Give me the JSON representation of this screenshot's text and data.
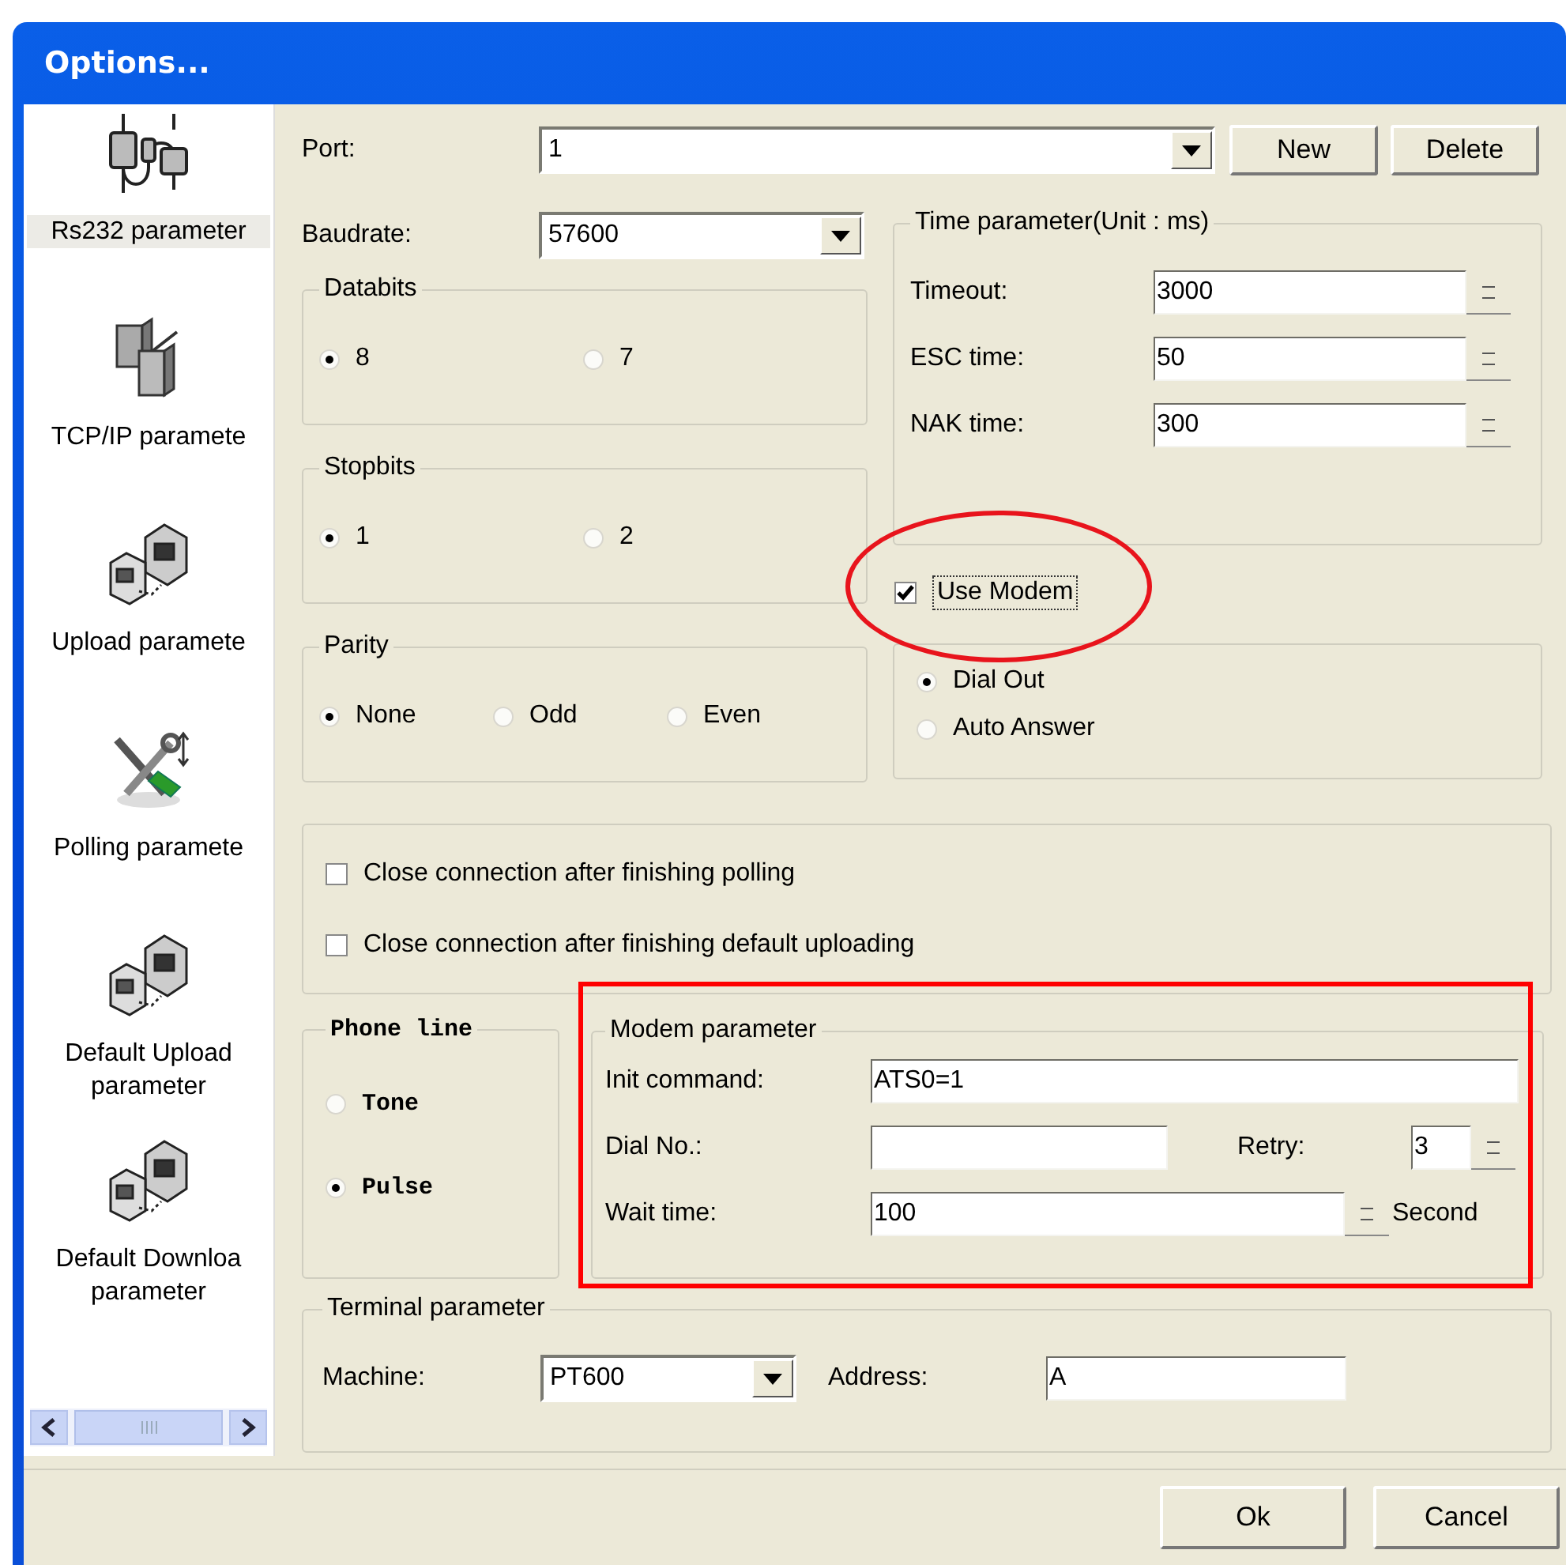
{
  "window": {
    "title": "Options..."
  },
  "sidebar": {
    "items": [
      {
        "label": "Rs232 parameter",
        "kind": "cable",
        "selected": true
      },
      {
        "label": "TCP/IP paramete",
        "kind": "servers",
        "selected": false
      },
      {
        "label": "Upload paramete",
        "kind": "computers",
        "selected": false
      },
      {
        "label": "Polling paramete",
        "kind": "tools",
        "selected": false
      },
      {
        "label": "Default Upload parameter",
        "kind": "computers",
        "selected": false
      },
      {
        "label": "Default Downloa parameter",
        "kind": "computers",
        "selected": false
      }
    ]
  },
  "port": {
    "label": "Port:",
    "value": "1"
  },
  "port_buttons": [
    "New",
    "Delete"
  ],
  "baudrate": {
    "label": "Baudrate:",
    "value": "57600"
  },
  "databits": {
    "legend": "Databits",
    "options": [
      {
        "label": "8",
        "selected": true
      },
      {
        "label": "7",
        "selected": false
      }
    ]
  },
  "stopbits": {
    "legend": "Stopbits",
    "options": [
      {
        "label": "1",
        "selected": true
      },
      {
        "label": "2",
        "selected": false
      }
    ]
  },
  "parity": {
    "legend": "Parity",
    "options": [
      {
        "label": "None",
        "selected": true
      },
      {
        "label": "Odd",
        "selected": false
      },
      {
        "label": "Even",
        "selected": false
      }
    ]
  },
  "time_parameter": {
    "legend": "Time parameter(Unit : ms)",
    "fields": [
      {
        "label": "Timeout:",
        "value": "3000"
      },
      {
        "label": "ESC time:",
        "value": "50"
      },
      {
        "label": "NAK time:",
        "value": "300"
      }
    ]
  },
  "use_modem": {
    "label": "Use Modem",
    "checked": true,
    "focused": true,
    "highlighted": true
  },
  "dial_mode": {
    "options": [
      {
        "label": "Dial Out",
        "selected": true
      },
      {
        "label": "Auto Answer",
        "selected": false
      }
    ]
  },
  "polling_options": [
    {
      "label": "Close connection after finishing polling",
      "checked": false
    },
    {
      "label": "Close connection after finishing default uploading",
      "checked": false
    }
  ],
  "phone_line": {
    "legend": "Phone line",
    "options": [
      {
        "label": "Tone",
        "selected": false
      },
      {
        "label": "Pulse",
        "selected": true
      }
    ]
  },
  "modem_parameter": {
    "legend": "Modem parameter",
    "highlighted": true,
    "init_command": {
      "label": "Init command:",
      "value": "ATS0=1"
    },
    "dial_no": {
      "label": "Dial No.:"
    },
    "retry": {
      "label": "Retry:",
      "value": "3"
    },
    "wait_time": {
      "label": "Wait time:",
      "value": "100",
      "unit": "Second"
    }
  },
  "terminal_parameter": {
    "legend": "Terminal parameter",
    "machine": {
      "label": "Machine:",
      "value": "PT600"
    },
    "address": {
      "label": "Address:",
      "value": "A"
    }
  },
  "buttons": [
    "Ok",
    "Cancel"
  ]
}
